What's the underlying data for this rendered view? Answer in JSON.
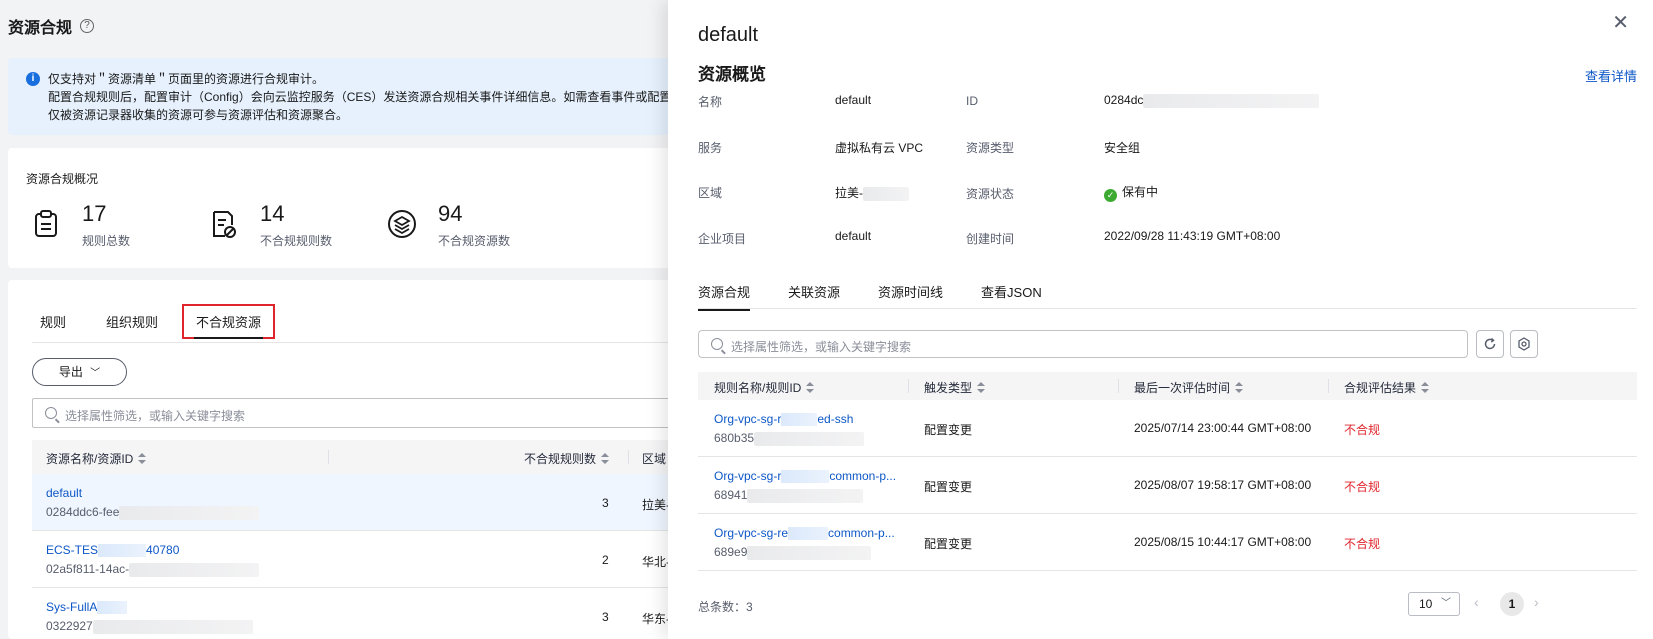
{
  "page": {
    "title": "资源合规",
    "help_icon": "question-circle-icon"
  },
  "notice": {
    "line1": "仅支持对＂资源清单＂页面里的资源进行合规审计。",
    "line2": "配置合规规则后，配置审计（Config）会向云监控服务（CES）发送资源合规相关事件详细信息。如需查看事件或配置事件",
    "line3": "仅被资源记录器收集的资源可参与资源评估和资源聚合。"
  },
  "overview": {
    "title": "资源合规概况",
    "stats": [
      {
        "value": "17",
        "label": "规则总数",
        "icon": "clipboard-icon"
      },
      {
        "value": "14",
        "label": "不合规规则数",
        "icon": "doc-noncompliant-icon"
      },
      {
        "value": "94",
        "label": "不合规资源数",
        "icon": "layers-icon"
      }
    ]
  },
  "left_tabs": [
    "规则",
    "组织规则",
    "不合规资源"
  ],
  "export_label": "导出",
  "left_search_placeholder": "选择属性筛选，或输入关键字搜索",
  "left_table": {
    "headers": {
      "name": "资源名称/资源ID",
      "count": "不合规规则数",
      "region": "区域"
    },
    "rows": [
      {
        "name": "default",
        "id": "0284ddc6-fee",
        "count": "3",
        "region": "拉美-"
      },
      {
        "name_prefix": "ECS-TES",
        "name_suffix": "40780",
        "id": "02a5f811-14ac-",
        "count": "2",
        "region": "华北-"
      },
      {
        "name": "Sys-FullA",
        "id": "0322927",
        "count": "3",
        "region": "华东-"
      }
    ]
  },
  "drawer": {
    "title": "default",
    "section_title": "资源概览",
    "detail_link": "查看详情",
    "props": {
      "name_k": "名称",
      "name_v": "default",
      "id_k": "ID",
      "id_v": "0284dc",
      "service_k": "服务",
      "service_v": "虚拟私有云 VPC",
      "type_k": "资源类型",
      "type_v": "安全组",
      "region_k": "区域",
      "region_v": "拉美-",
      "state_k": "资源状态",
      "state_v": "保有中",
      "project_k": "企业项目",
      "project_v": "default",
      "created_k": "创建时间",
      "created_v": "2022/09/28 11:43:19 GMT+08:00"
    },
    "tabs": [
      "资源合规",
      "关联资源",
      "资源时间线",
      "查看JSON"
    ],
    "search_placeholder": "选择属性筛选，或输入关键字搜索",
    "table": {
      "headers": {
        "rule": "规则名称/规则ID",
        "trigger": "触发类型",
        "time": "最后一次评估时间",
        "result": "合规评估结果"
      },
      "rows": [
        {
          "name_a": "Org-vpc-sg-r",
          "name_b": "ed-ssh",
          "id": "680b35",
          "trigger": "配置变更",
          "time": "2025/07/14 23:00:44 GMT+08:00",
          "result": "不合规"
        },
        {
          "name_a": "Org-vpc-sg-r",
          "name_b": "common-p...",
          "id": "68941",
          "trigger": "配置变更",
          "time": "2025/08/07 19:58:17 GMT+08:00",
          "result": "不合规"
        },
        {
          "name_a": "Org-vpc-sg-re",
          "name_b": "common-p...",
          "id": "689e9",
          "trigger": "配置变更",
          "time": "2025/08/15 10:44:17 GMT+08:00",
          "result": "不合规"
        }
      ]
    },
    "total_label": "总条数：3",
    "page_size": "10",
    "current_page": "1"
  }
}
